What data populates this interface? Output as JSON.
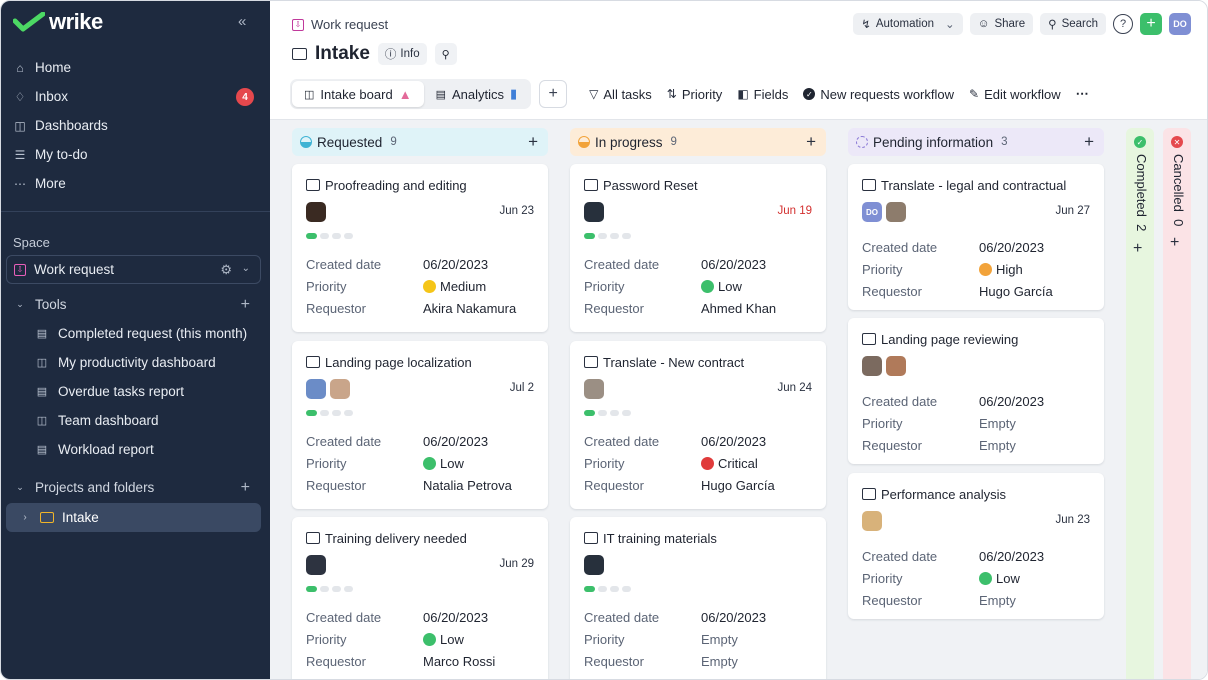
{
  "sidebar": {
    "logo": "wrike",
    "nav": [
      {
        "label": "Home",
        "icon": "home-icon"
      },
      {
        "label": "Inbox",
        "icon": "bell-icon",
        "badge": "4"
      },
      {
        "label": "Dashboards",
        "icon": "dashboard-icon"
      },
      {
        "label": "My to-do",
        "icon": "todo-icon"
      },
      {
        "label": "More",
        "icon": "more-icon"
      }
    ],
    "space_label": "Space",
    "space_name": "Work request",
    "tools_label": "Tools",
    "tools": [
      {
        "label": "Completed request (this month)",
        "icon": "report-icon"
      },
      {
        "label": "My productivity dashboard",
        "icon": "dashboard-icon"
      },
      {
        "label": "Overdue tasks report",
        "icon": "report-icon"
      },
      {
        "label": "Team dashboard",
        "icon": "dashboard-icon"
      },
      {
        "label": "Workload report",
        "icon": "report-icon"
      }
    ],
    "projects_label": "Projects and folders",
    "folder": "Intake"
  },
  "header": {
    "breadcrumb": "Work request",
    "title": "Intake",
    "info_label": "Info",
    "automation_label": "Automation",
    "share_label": "Share",
    "search_label": "Search",
    "avatar": "DO"
  },
  "toolbar": {
    "tabs": [
      {
        "label": "Intake board"
      },
      {
        "label": "Analytics"
      }
    ],
    "all_tasks": "All tasks",
    "priority": "Priority",
    "fields": "Fields",
    "workflow": "New requests workflow",
    "edit_workflow": "Edit workflow"
  },
  "labels": {
    "created": "Created date",
    "priority": "Priority",
    "requestor": "Requestor"
  },
  "columns": [
    {
      "name": "Requested",
      "count": "9",
      "color": "#dff3f8",
      "icon_color": "#3fb3d4",
      "cards": [
        {
          "title": "Proofreading and editing",
          "date": "Jun 23",
          "created": "06/20/2023",
          "priority": "Medium",
          "pcolor": "#f5c518",
          "requestor": "Akira Nakamura"
        },
        {
          "title": "Landing page localization",
          "date": "Jul 2",
          "created": "06/20/2023",
          "priority": "Low",
          "pcolor": "#3cbf6b",
          "requestor": "Natalia Petrova"
        },
        {
          "title": "Training delivery needed",
          "date": "Jun 29",
          "created": "06/20/2023",
          "priority": "Low",
          "pcolor": "#3cbf6b",
          "requestor": "Marco Rossi"
        }
      ]
    },
    {
      "name": "In progress",
      "count": "9",
      "color": "#fdecd8",
      "icon_color": "#f2a33a",
      "cards": [
        {
          "title": "Password Reset",
          "date": "Jun 19",
          "created": "06/20/2023",
          "priority": "Low",
          "pcolor": "#3cbf6b",
          "requestor": "Ahmed Khan"
        },
        {
          "title": "Translate - New contract",
          "date": "Jun 24",
          "created": "06/20/2023",
          "priority": "Critical",
          "pcolor": "#e03b3b",
          "requestor": "Hugo García"
        },
        {
          "title": "IT training materials",
          "date": "",
          "created": "06/20/2023",
          "priority": "Empty",
          "pcolor": "",
          "requestor": "Empty"
        }
      ]
    },
    {
      "name": "Pending information",
      "count": "3",
      "color": "#ece8f8",
      "icon_color": "#8a79d6",
      "cards": [
        {
          "title": "Translate - legal and contractual",
          "date": "Jun 27",
          "created": "06/20/2023",
          "priority": "High",
          "pcolor": "#f2a33a",
          "requestor": "Hugo García"
        },
        {
          "title": "Landing page reviewing",
          "date": "",
          "created": "06/20/2023",
          "priority": "Empty",
          "pcolor": "",
          "requestor": "Empty"
        },
        {
          "title": "Performance analysis",
          "date": "Jun 23",
          "created": "06/20/2023",
          "priority": "Low",
          "pcolor": "#3cbf6b",
          "requestor": "Empty"
        }
      ]
    }
  ],
  "collapsed": [
    {
      "name": "Completed",
      "count": "2",
      "color": "#e7f6df",
      "icon_color": "#3cbf6b"
    },
    {
      "name": "Cancelled",
      "count": "0",
      "color": "#fbe3e6",
      "icon_color": "#e5484d"
    }
  ]
}
